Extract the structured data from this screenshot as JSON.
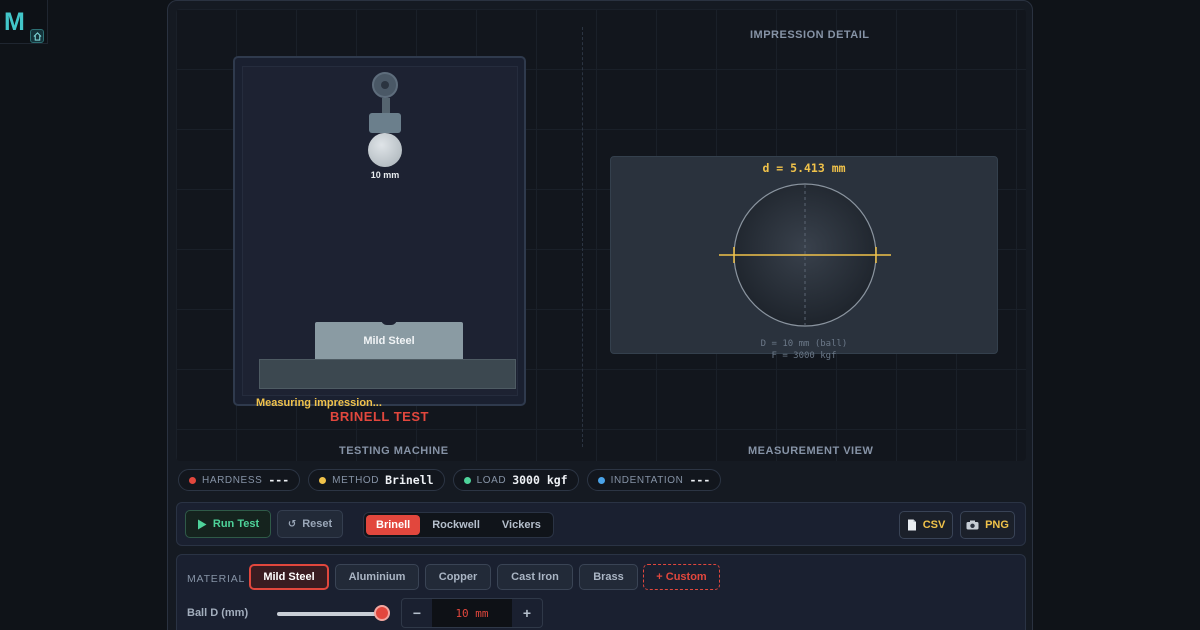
{
  "app": {
    "logo_letter": "M"
  },
  "stage": {
    "impression_title": "IMPRESSION DETAIL",
    "machine_label": "TESTING MACHINE",
    "measurement_label": "MEASUREMENT VIEW",
    "ball_size_label": "10 mm",
    "specimen_label": "Mild Steel",
    "status_text": "Measuring impression...",
    "test_title": "BRINELL TEST",
    "diameter_readout": "d = 5.413 mm",
    "ball_caption": "D = 10 mm (ball)",
    "load_caption": "F = 3000 kgf"
  },
  "stats": [
    {
      "key": "HARDNESS",
      "value": "---",
      "color": "#e2473d"
    },
    {
      "key": "METHOD",
      "value": "Brinell",
      "color": "#f0c24a"
    },
    {
      "key": "LOAD",
      "value": "3000 kgf",
      "color": "#4ed39a"
    },
    {
      "key": "INDENTATION",
      "value": "---",
      "color": "#4aa3e8"
    }
  ],
  "controls": {
    "run_label": "Run Test",
    "reset_label": "Reset",
    "methods": [
      "Brinell",
      "Rockwell",
      "Vickers"
    ],
    "active_method": "Brinell",
    "csv_label": "CSV",
    "png_label": "PNG"
  },
  "materials": {
    "label": "MATERIAL",
    "items": [
      "Mild Steel",
      "Aluminium",
      "Copper",
      "Cast Iron",
      "Brass"
    ],
    "active": "Mild Steel",
    "custom_label": "+ Custom"
  },
  "ball_d": {
    "label": "Ball D (mm)",
    "value": "10 mm",
    "slider_fraction": 1.0
  },
  "colors": {
    "accent": "#e2473d",
    "highlight": "#f0c24a",
    "success": "#4ed39a",
    "info": "#4aa3e8"
  }
}
